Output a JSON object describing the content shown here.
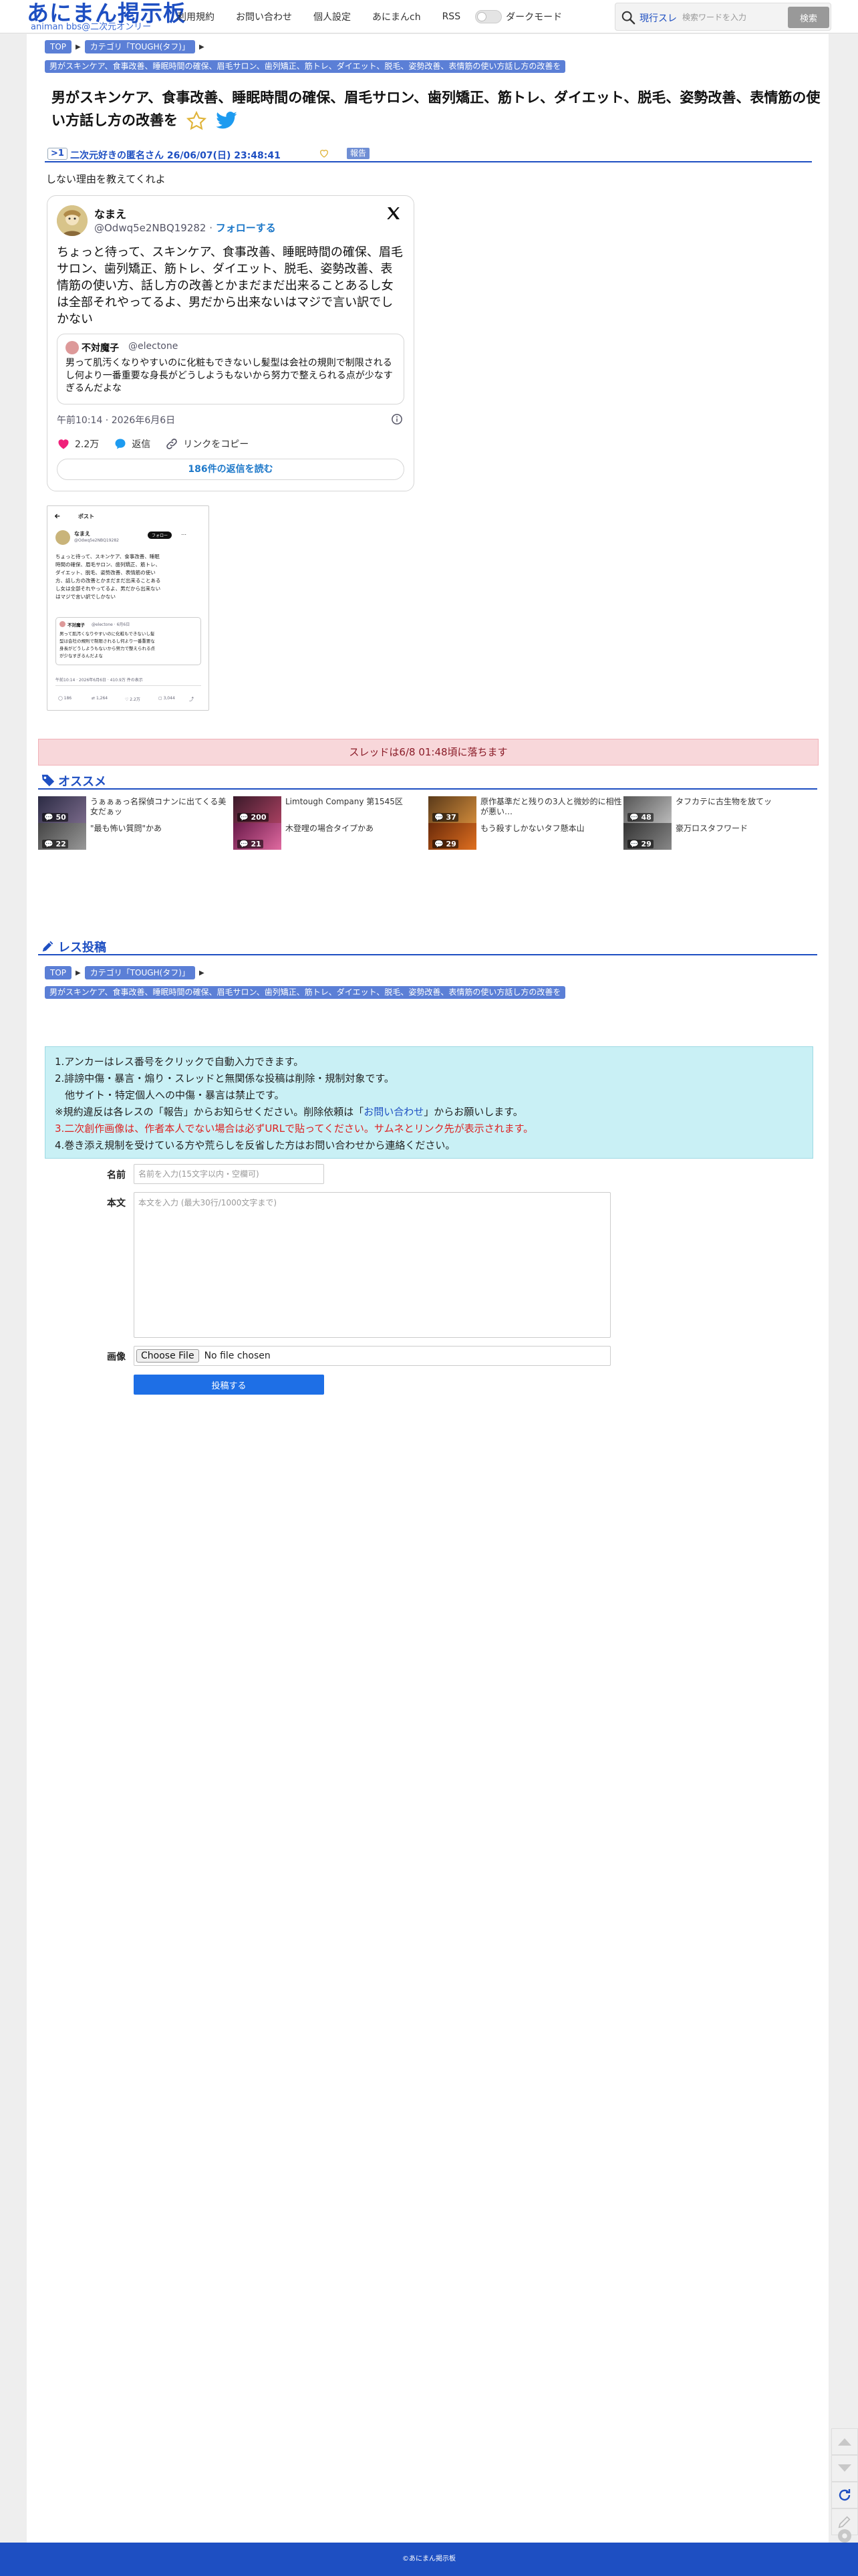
{
  "header": {
    "logo_main": "あにまん掲示板",
    "logo_sub": "animan bbs@二次元オンリー",
    "nav": [
      "利用規約",
      "お問い合わせ",
      "個人設定",
      "あにまんch",
      "RSS"
    ],
    "dark_mode_label": "ダークモード",
    "search_mode": "現行スレ",
    "search_placeholder": "検索ワードを入力",
    "search_button": "検索"
  },
  "breadcrumbs": [
    "TOP",
    "カテゴリ「TOUGH(タフ)」"
  ],
  "tag": "男がスキンケア、食事改善、睡眠時間の確保、眉毛サロン、歯列矯正、筋トレ、ダイエット、脱毛、姿勢改善、表情筋の使い方話し方の改善を",
  "thread_title": "男がスキンケア、食事改善、睡眠時間の確保、眉毛サロン、歯列矯正、筋トレ、ダイエット、脱毛、姿勢改善、表情筋の使い方話し方の改善を",
  "post": {
    "number": ">1",
    "name_date": "二次元好きの匿名さん 26/06/07(日) 23:48:41",
    "report": "報告",
    "body": "しない理由を教えてくれよ"
  },
  "tweet": {
    "name": "なまえ",
    "handle": "@Odwq5e2NBQ19282 · ",
    "follow": "フォローする",
    "text": "ちょっと待って、スキンケア、食事改善、睡眠時間の確保、眉毛サロン、歯列矯正、筋トレ、ダイエット、脱毛、姿勢改善、表情筋の使い方、話し方の改善とかまだまだ出来ることあるし女は全部それやってるよ、男だから出来ないはマジで言い訳でしかない",
    "quote_name": "不対魔子",
    "quote_handle": "@electone",
    "quote_text": "男って肌汚くなりやすいのに化粧もできないし髪型は会社の規則で制限されるし何より一番重要な身長がどうしようもないから努力で整えられる点が少なすぎるんだよな",
    "date": "午前10:14 · 2026年6月6日",
    "likes": "2.2万",
    "reply": "返信",
    "copy_link": "リンクをコピー",
    "read_replies": "186件の返信を読む"
  },
  "screenshot": {
    "header": "ポスト",
    "name": "なまえ",
    "handle": "@Odwq5e2NBQ19282",
    "follow": "フォロー",
    "lines": [
      "ちょっと待って、スキンケア、食事改善、睡眠",
      "時間の確保、眉毛サロン、歯列矯正、筋トレ、",
      "ダイエット、脱毛、姿勢改善、表情筋の使い",
      "方、話し方の改善とかまだまだ出来ることある",
      "し女は全部それやってるよ、男だから出来ない",
      "はマジで言い訳でしかない"
    ],
    "quote_name": "不対魔子",
    "quote_handle": "@electone · 6月6日",
    "quote_lines": [
      "男って肌汚くなりやすいのに化粧もできないし髪",
      "型は会社の規則で制限されるし何より一番重要な",
      "身長がどうしようもないから努力で整えられる点",
      "が少なすぎるんだよな"
    ],
    "meta": "午前10:14 · 2026年6月6日 · 410.9万 件の表示",
    "stats": [
      "186",
      "1,264",
      "2.2万",
      "3,044"
    ]
  },
  "notice": "スレッドは6/8 01:48頃に落ちます",
  "recommend_label": "オススメ",
  "recommendations": [
    {
      "title": "うぁぁぁっ名探偵コナンに出てくる美女だぁッ",
      "count": "50"
    },
    {
      "title": "Limtough Company 第1545区",
      "count": "200"
    },
    {
      "title": "原作基準だと残りの3人と微妙的に相性が悪い…",
      "count": "37"
    },
    {
      "title": "タフカテに古生物を放てッ",
      "count": "48"
    },
    {
      "title": "\"最も怖い質問\"かあ",
      "count": "22"
    },
    {
      "title": "木登哩の場合タイプかあ",
      "count": "21"
    },
    {
      "title": "もう殺すしかないタフ懸本山",
      "count": "29"
    },
    {
      "title": "豪万ロスタフワード",
      "count": "29"
    }
  ],
  "post_form": {
    "heading": "レス投稿",
    "rules": [
      "1.アンカーはレス番号をクリックで自動入力できます。",
      "2.誹謗中傷・暴言・煽り・スレッドと無関係な投稿は削除・規制対象です。",
      "　他サイト・特定個人への中傷・暴言は禁止です。",
      "※規約違反は各レスの「報告」からお知らせください。削除依頼は「",
      "お問い合わせ",
      "」からお願いします。",
      "3.二次創作画像は、作者本人でない場合は必ずURLで貼ってください。サムネとリンク先が表示されます。",
      "4.巻き添え規制を受けている方や荒らしを反省した方はお問い合わせから連絡ください。"
    ],
    "name_label": "名前",
    "name_placeholder": "名前を入力(15文字以内・空欄可)",
    "body_label": "本文",
    "body_placeholder": "本文を入力 (最大30行/1000文字まで)",
    "image_label": "画像",
    "file_button": "Choose File",
    "file_status": "No file chosen",
    "submit": "投稿する"
  },
  "footer": "©あにまん掲示板",
  "colors": {
    "brand": "#1e4fc2",
    "tag": "#5b7fd6",
    "notice_bg": "#f8d7da",
    "rules_bg": "#c9f0f5",
    "submit": "#1e6fe6"
  }
}
